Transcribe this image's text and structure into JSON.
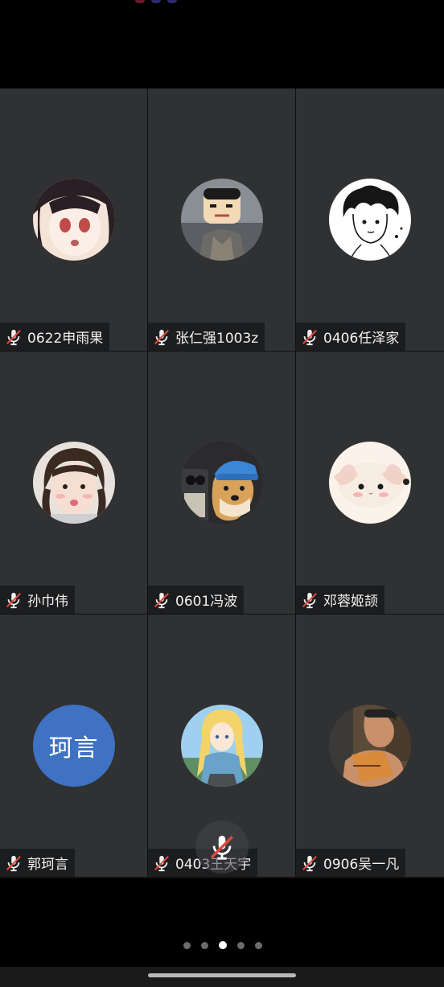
{
  "participants": [
    {
      "name": "0622申雨果",
      "avatar": "anime-girl-avatar"
    },
    {
      "name": "张仁强1003z",
      "avatar": "cartoon-boy-avatar"
    },
    {
      "name": "0406任泽家",
      "avatar": "sketch-boy-avatar"
    },
    {
      "name": "孙巾伟",
      "avatar": "child-photo-avatar"
    },
    {
      "name": "0601冯波",
      "avatar": "shiba-dog-avatar"
    },
    {
      "name": "邓蓉姬颉",
      "avatar": "sheep-avatar"
    },
    {
      "name": "郭珂言",
      "avatar": "text-avatar",
      "avatar_text": "珂言",
      "avatar_color": "#3f72c3"
    },
    {
      "name": "0403王天宇",
      "avatar": "anime-blonde-avatar"
    },
    {
      "name": "0906吴一凡",
      "avatar": "man-photo-avatar"
    }
  ],
  "pagination": {
    "total": 5,
    "active": 3
  },
  "icons": {
    "label_icon": "mic-off-icon",
    "floating_icon": "mic-off-icon"
  },
  "colors": {
    "tile_bg": "#303133",
    "label_bg": "#1c1d1f",
    "mute_red": "#e0483e"
  }
}
